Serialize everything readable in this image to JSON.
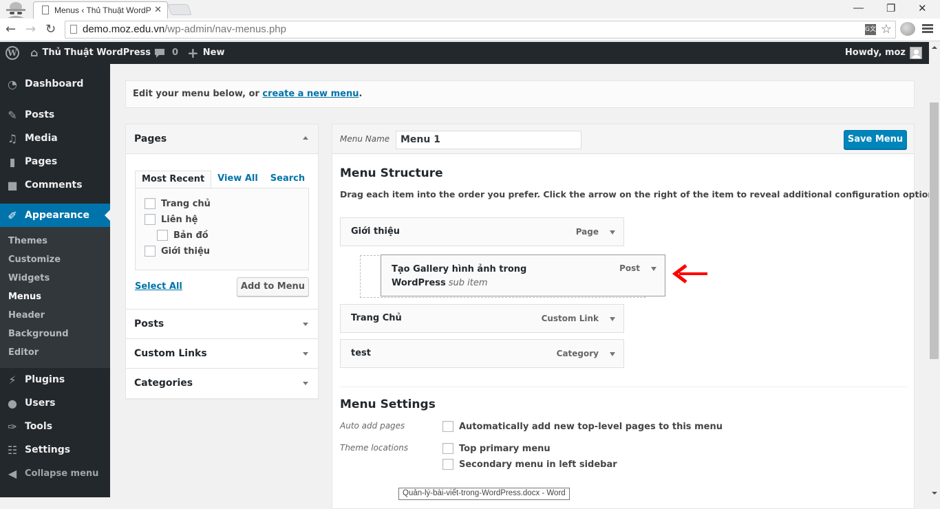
{
  "browser": {
    "tab_title": "Menus ‹ Thủ Thuật WordP",
    "url_host": "demo.moz.edu.vn",
    "url_path": "/wp-admin/nav-menus.php",
    "translate_icon": "G文"
  },
  "adminbar": {
    "site_name": "Thủ Thuật WordPress",
    "comments_count": "0",
    "new_label": "New",
    "howdy": "Howdy, moz"
  },
  "sidebar": {
    "items": [
      {
        "label": "Dashboard",
        "icon": "dashboard-icon"
      },
      {
        "label": "Posts",
        "icon": "pin-icon"
      },
      {
        "label": "Media",
        "icon": "media-icon"
      },
      {
        "label": "Pages",
        "icon": "pages-icon"
      },
      {
        "label": "Comments",
        "icon": "comment-icon"
      },
      {
        "label": "Appearance",
        "icon": "brush-icon"
      },
      {
        "label": "Plugins",
        "icon": "plug-icon"
      },
      {
        "label": "Users",
        "icon": "user-icon"
      },
      {
        "label": "Tools",
        "icon": "wrench-icon"
      },
      {
        "label": "Settings",
        "icon": "sliders-icon"
      },
      {
        "label": "Collapse menu",
        "icon": "collapse-icon"
      }
    ],
    "submenu": [
      "Themes",
      "Customize",
      "Widgets",
      "Menus",
      "Header",
      "Background",
      "Editor"
    ],
    "current_submenu": "Menus"
  },
  "notice": {
    "text": "Edit your menu below, or ",
    "link": "create a new menu",
    "suffix": "."
  },
  "accordion": {
    "pages": {
      "title": "Pages",
      "tabs": [
        "Most Recent",
        "View All",
        "Search"
      ],
      "active_tab": "Most Recent",
      "items": [
        {
          "label": "Trang chủ",
          "checked": false,
          "level": 0
        },
        {
          "label": "Liên hệ",
          "checked": false,
          "level": 0
        },
        {
          "label": "Bản đồ",
          "checked": false,
          "level": 1
        },
        {
          "label": "Giới thiệu",
          "checked": false,
          "level": 0
        }
      ],
      "select_all": "Select All",
      "add_button": "Add to Menu"
    },
    "sections": [
      "Posts",
      "Custom Links",
      "Categories"
    ]
  },
  "menu_editor": {
    "name_label": "Menu Name",
    "name_value": "Menu 1",
    "save_button": "Save Menu",
    "structure_title": "Menu Structure",
    "structure_desc": "Drag each item into the order you prefer. Click the arrow on the right of the item to reveal additional configuration options.",
    "items": [
      {
        "title": "Giới thiệu",
        "type": "Page"
      },
      {
        "title_line1": "Tạo Gallery hình ảnh trong",
        "title_line2": "WordPress",
        "sub_label": "sub item",
        "type": "Post"
      },
      {
        "title": "Trang Chủ",
        "type": "Custom Link"
      },
      {
        "title": "test",
        "type": "Category"
      }
    ],
    "settings_title": "Menu Settings",
    "auto_add_label": "Auto add pages",
    "auto_add_option": "Automatically add new top-level pages to this menu",
    "theme_locations_label": "Theme locations",
    "locations": [
      "Top primary menu",
      "Secondary menu in left sidebar"
    ]
  },
  "tooltip": "Quản-lý-bài-viết-trong-WordPress.docx - Word",
  "colors": {
    "accent": "#0073aa",
    "primary_button": "#0085ba",
    "admin_dark": "#23282d",
    "annotation_arrow": "#ff0000"
  }
}
